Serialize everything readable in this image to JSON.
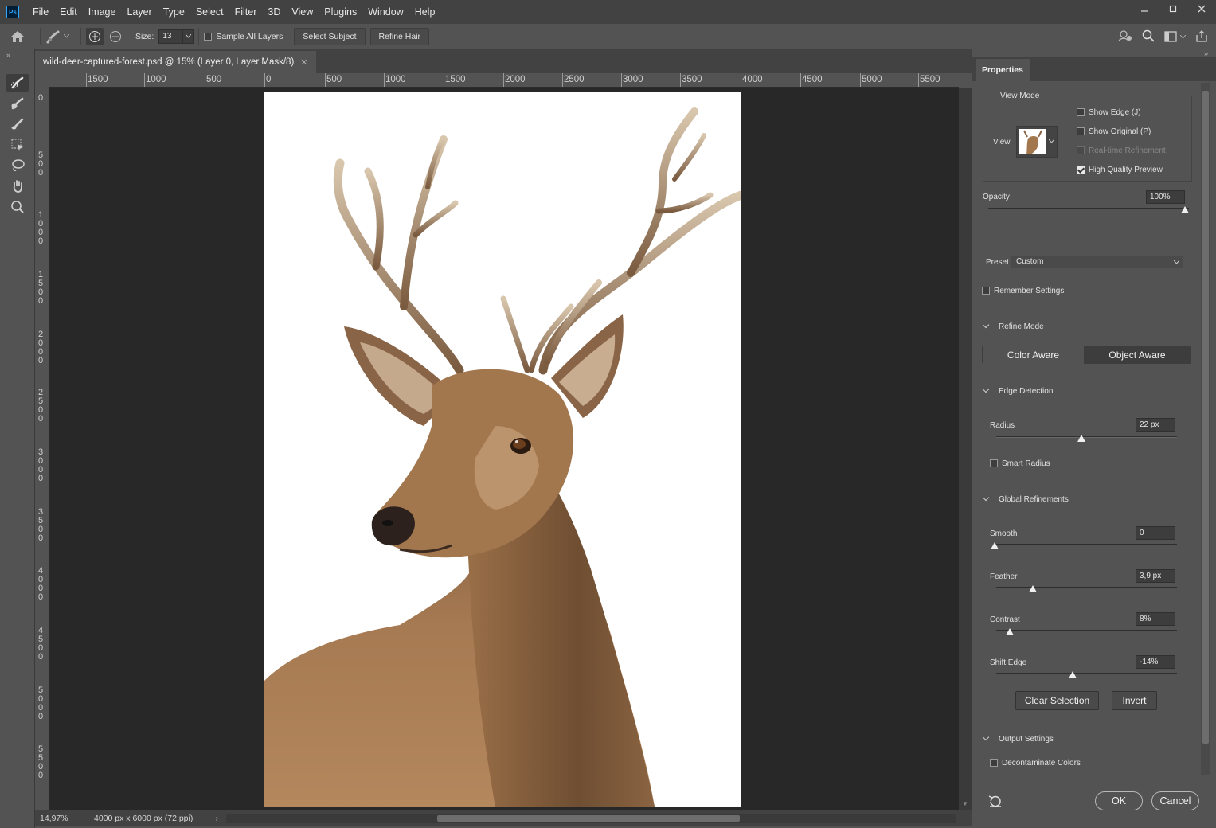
{
  "app": {
    "logo_text": "Ps"
  },
  "menu": [
    "File",
    "Edit",
    "Image",
    "Layer",
    "Type",
    "Select",
    "Filter",
    "3D",
    "View",
    "Plugins",
    "Window",
    "Help"
  ],
  "options_bar": {
    "size_label": "Size:",
    "size_value": "13",
    "sample_all_layers": "Sample All Layers",
    "select_subject": "Select Subject",
    "refine_hair": "Refine Hair"
  },
  "document": {
    "tab_title": "wild-deer-captured-forest.psd @ 15% (Layer 0, Layer Mask/8)",
    "zoom": "14,97%",
    "info": "4000 px x 6000 px (72 ppi)"
  },
  "rulers": {
    "horizontal": [
      "1500",
      "1000",
      "500",
      "0",
      "500",
      "1000",
      "1500",
      "2000",
      "2500",
      "3000",
      "3500",
      "4000",
      "4500",
      "5000",
      "5500"
    ],
    "vertical": [
      "0",
      "500",
      "1000",
      "1500",
      "2000",
      "2500",
      "3000",
      "3500",
      "4000",
      "4500",
      "5000",
      "5500"
    ]
  },
  "properties": {
    "tab": "Properties",
    "view_mode": {
      "title": "View Mode",
      "view_label": "View",
      "show_edge": "Show Edge (J)",
      "show_original": "Show Original (P)",
      "realtime": "Real-time Refinement",
      "high_quality": "High Quality Preview"
    },
    "opacity": {
      "label": "Opacity",
      "value": "100%",
      "level": 100
    },
    "preset": {
      "label": "Preset",
      "value": "Custom"
    },
    "remember_settings": "Remember Settings",
    "refine_mode": {
      "title": "Refine Mode",
      "options": [
        "Color Aware",
        "Object Aware"
      ],
      "selected": "Object Aware"
    },
    "edge_detection": {
      "title": "Edge Detection",
      "radius_label": "Radius",
      "radius_value": "22 px",
      "radius_level": 0.47,
      "smart_radius": "Smart Radius"
    },
    "global_refinements": {
      "title": "Global Refinements",
      "smooth": {
        "label": "Smooth",
        "value": "0",
        "level": 0.0
      },
      "feather": {
        "label": "Feather",
        "value": "3,9 px",
        "level": 0.2
      },
      "contrast": {
        "label": "Contrast",
        "value": "8%",
        "level": 0.08
      },
      "shift_edge": {
        "label": "Shift Edge",
        "value": "-14%",
        "level": 0.43
      }
    },
    "clear_selection": "Clear Selection",
    "invert": "Invert",
    "output_settings": {
      "title": "Output Settings",
      "decontaminate": "Decontaminate Colors"
    },
    "ok": "OK",
    "cancel": "Cancel"
  },
  "icons": {
    "tools": [
      "quick-selection-icon",
      "refine-edge-brush-icon",
      "brush-icon",
      "object-selection-icon",
      "lasso-icon",
      "hand-icon",
      "zoom-icon"
    ]
  },
  "colors": {
    "canvas_bg": "#282828",
    "panel_bg": "#535353",
    "menubar_bg": "#424242",
    "deer_fur": "#a67a52"
  }
}
